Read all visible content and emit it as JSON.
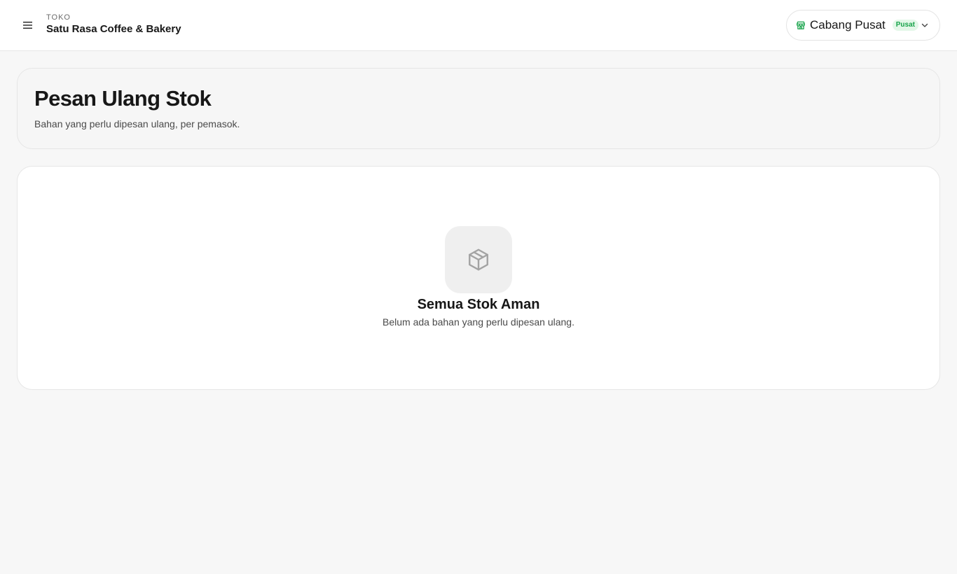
{
  "header": {
    "store_kicker": "TOKO",
    "store_name": "Satu Rasa Coffee & Bakery",
    "menu_icon": "hamburger-menu-icon",
    "branch": {
      "icon": "store-icon",
      "name": "Cabang Pusat",
      "badge": "Pusat",
      "chevron_icon": "chevron-down-icon"
    }
  },
  "page": {
    "title": "Pesan Ulang Stok",
    "subtitle": "Bahan yang perlu dipesan ulang, per pemasok."
  },
  "empty_state": {
    "icon": "package-icon",
    "title": "Semua Stok Aman",
    "description": "Belum ada bahan yang perlu dipesan ulang."
  },
  "colors": {
    "background": "#f7f7f7",
    "card": "#ffffff",
    "badge_bg": "#e3f7e8",
    "badge_text": "#17a34a",
    "store_icon": "#16a34a"
  }
}
